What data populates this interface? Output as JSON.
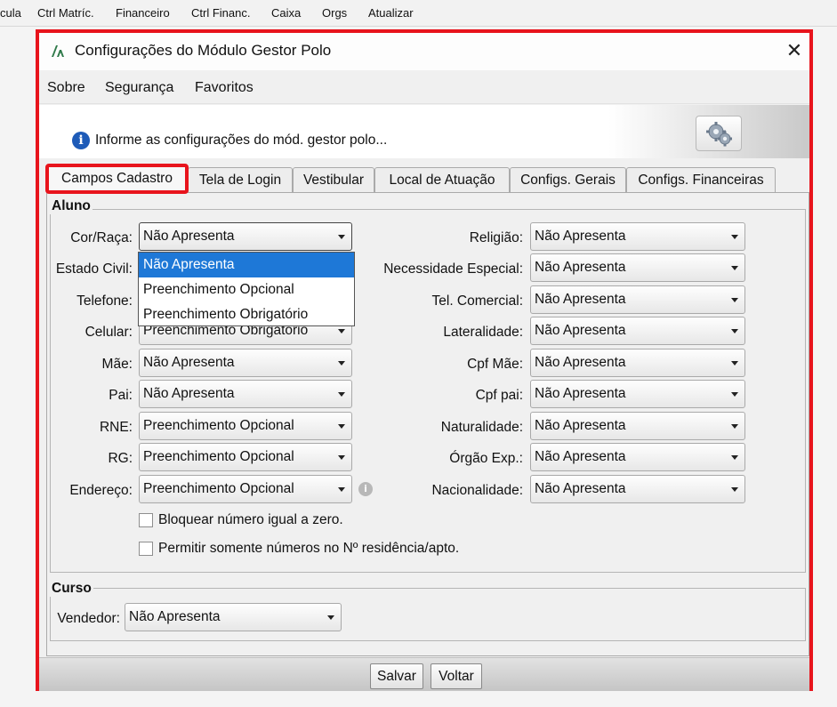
{
  "app_menu": [
    "cula",
    "Ctrl Matríc.",
    "Financeiro",
    "Ctrl Financ.",
    "Caixa",
    "Orgs",
    "Atualizar"
  ],
  "window": {
    "title": "Configurações do Módulo Gestor Polo",
    "close_symbol": "✕"
  },
  "menu": [
    "Sobre",
    "Segurança",
    "Favoritos"
  ],
  "info": {
    "icon": "i",
    "text": "Informe as configurações do mód. gestor polo..."
  },
  "tabs": [
    "Campos Cadastro",
    "Tela de Login",
    "Vestibular",
    "Local de Atuação",
    "Configs. Gerais",
    "Configs. Financeiras"
  ],
  "aluno": {
    "title": "Aluno",
    "left": [
      {
        "label": "Cor/Raça:",
        "value": "Não Apresenta"
      },
      {
        "label": "Estado Civil:",
        "value": ""
      },
      {
        "label": "Telefone:",
        "value": ""
      },
      {
        "label": "Celular:",
        "value": "Preenchimento Obrigatório"
      },
      {
        "label": "Mãe:",
        "value": "Não Apresenta"
      },
      {
        "label": "Pai:",
        "value": "Não Apresenta"
      },
      {
        "label": "RNE:",
        "value": "Preenchimento Opcional"
      },
      {
        "label": "RG:",
        "value": "Preenchimento Opcional"
      },
      {
        "label": "Endereço:",
        "value": "Preenchimento Opcional"
      }
    ],
    "right": [
      {
        "label": "Religião:",
        "value": "Não Apresenta"
      },
      {
        "label": "Necessidade Especial:",
        "value": "Não Apresenta"
      },
      {
        "label": "Tel. Comercial:",
        "value": "Não Apresenta"
      },
      {
        "label": "Lateralidade:",
        "value": "Não Apresenta"
      },
      {
        "label": "Cpf Mãe:",
        "value": "Não Apresenta"
      },
      {
        "label": "Cpf pai:",
        "value": "Não Apresenta"
      },
      {
        "label": "Naturalidade:",
        "value": "Não Apresenta"
      },
      {
        "label": "Órgão Exp.:",
        "value": "Não Apresenta"
      },
      {
        "label": "Nacionalidade:",
        "value": "Não Apresenta"
      }
    ],
    "help_icon": "i",
    "checkboxes": [
      {
        "label": "Bloquear número igual a zero.",
        "checked": false
      },
      {
        "label": "Permitir somente números no Nº residência/apto.",
        "checked": false
      }
    ]
  },
  "dropdown_options": [
    "Não Apresenta",
    "Preenchimento Opcional",
    "Preenchimento Obrigatório"
  ],
  "curso": {
    "title": "Curso",
    "label": "Vendedor:",
    "value": "Não Apresenta"
  },
  "buttons": {
    "save": "Salvar",
    "back": "Voltar"
  },
  "colors": {
    "highlight_border": "#e8141c",
    "selection": "#1e78d7",
    "info_icon": "#1e5bb8"
  }
}
